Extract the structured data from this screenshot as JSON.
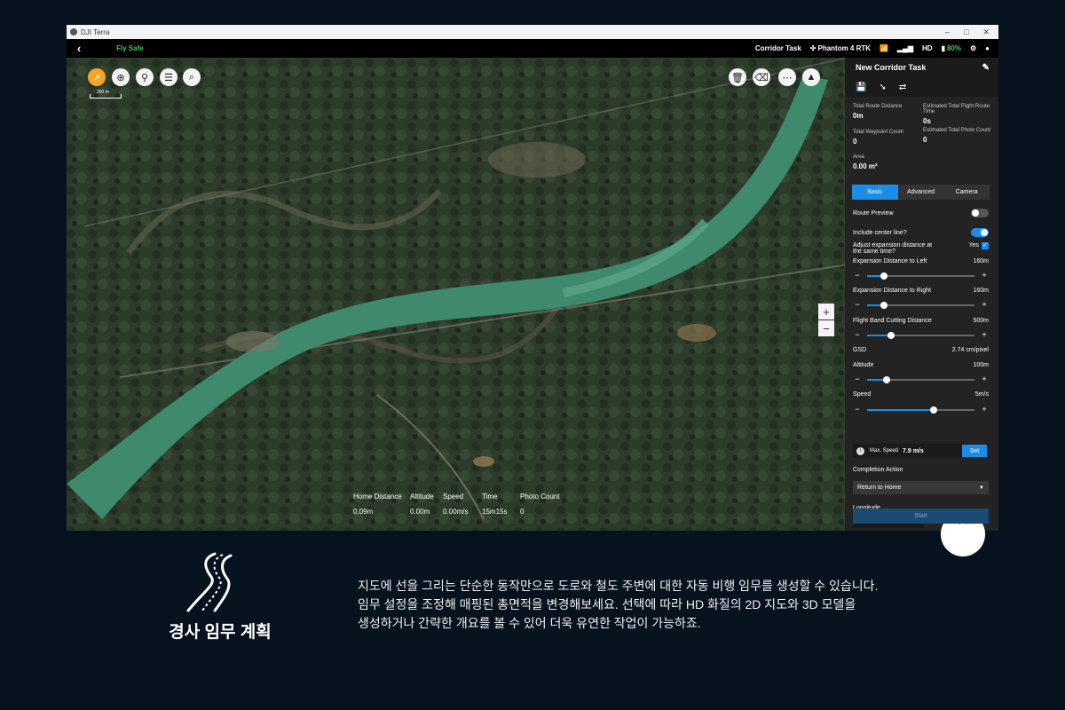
{
  "window": {
    "app_title": "DJI Terra"
  },
  "topbar": {
    "fly_safe": "Fly Safe",
    "task_type": "Corridor Task",
    "aircraft": "Phantom 4 RTK",
    "hd_label": "HD",
    "battery": "80%"
  },
  "map": {
    "scale_label": "200 m",
    "stats": {
      "home_distance": {
        "label": "Home Distance",
        "value": "0.09m"
      },
      "altitude": {
        "label": "Altitude",
        "value": "0.00m"
      },
      "speed": {
        "label": "Speed",
        "value": "0.00m/s"
      },
      "time": {
        "label": "Time",
        "value": "15m15s"
      },
      "photo_count": {
        "label": "Photo Count",
        "value": "0"
      }
    }
  },
  "panel": {
    "title": "New Corridor Task",
    "summary": {
      "total_route_distance": {
        "label": "Total Route Distance",
        "value": "0m"
      },
      "estimated_flight_time": {
        "label": "Estimated Total Flight Route Time",
        "value": "0s"
      },
      "total_waypoint_count": {
        "label": "Total Waypoint Count",
        "value": "0"
      },
      "estimated_photo_count": {
        "label": "Estimated Total Photo Count",
        "value": "0"
      },
      "area": {
        "label": "Area",
        "value": "0.00 m²"
      }
    },
    "tabs": [
      "Basic",
      "Advanced",
      "Camera"
    ],
    "route_preview": {
      "label": "Route Preview",
      "on": false
    },
    "include_center_line": {
      "label": "Include center line?",
      "on": true
    },
    "adjust_expansion": {
      "label": "Adjust expansion distance at the same time?",
      "value": "Yes"
    },
    "expansion_left": {
      "label": "Expansion Distance to Left",
      "value": "160m",
      "level": 0.16
    },
    "expansion_right": {
      "label": "Expansion Distance to Right",
      "value": "160m",
      "level": 0.16
    },
    "flight_band": {
      "label": "Flight Band Cutting Distance",
      "value": "500m",
      "level": 0.22
    },
    "gsd": {
      "label": "GSD",
      "value": "2.74 cm/pixel"
    },
    "altitude": {
      "label": "Altitude",
      "value": "100m",
      "level": 0.18
    },
    "speed": {
      "label": "Speed",
      "value": "5m/s",
      "level": 0.62
    },
    "max_speed": {
      "label": "Max. Speed",
      "value": "7.9 m/s",
      "button": "Set"
    },
    "completion": {
      "label": "Completion Action",
      "value": "Return to Home"
    },
    "longitude": {
      "label": "Longitude"
    },
    "start_button": "Start"
  },
  "caption": {
    "title": "경사 임무 계획",
    "lines": [
      "지도에 선을 그리는 단순한 동작만으로 도로와 철도 주변에 대한 자동 비행 임무를 생성할 수 있습니다.",
      "임무 설정을 조정해 매핑된 총면적을 변경해보세요. 선택에 따라 HD 화질의 2D 지도와 3D 모델을",
      "생성하거나 간략한 개요를 볼 수 있어 더욱 유연한 작업이 가능하죠."
    ]
  },
  "colors": {
    "accent": "#1a8de8",
    "fly_safe": "#47c45a",
    "tool_orange": "#f5a524"
  }
}
